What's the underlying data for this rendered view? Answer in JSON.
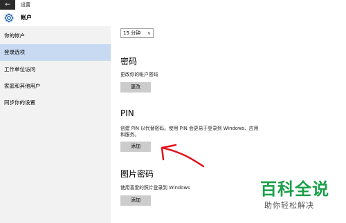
{
  "window": {
    "back_symbol": "←",
    "title": "设置"
  },
  "header": {
    "icon": "gear-icon",
    "title": "帐户"
  },
  "sidebar": {
    "items": [
      {
        "label": "你的帐户",
        "active": false
      },
      {
        "label": "登录选项",
        "active": true
      },
      {
        "label": "工作单位访问",
        "active": false
      },
      {
        "label": "家庭和其他用户",
        "active": false
      },
      {
        "label": "同步你的设置",
        "active": false
      }
    ]
  },
  "main": {
    "timeout_select": {
      "value": "15 分钟"
    },
    "password": {
      "title": "密码",
      "desc": "更改你的帐户密码",
      "button": "更改"
    },
    "pin": {
      "title": "PIN",
      "desc_line1": "创建 PIN 以代替密码。使用 PIN 会更易于登录到 Windows、应用",
      "desc_line2": "和服务。",
      "button": "添加"
    },
    "picture_password": {
      "title": "图片密码",
      "desc": "使用喜爱的照片登录到 Windows",
      "button": "添加"
    }
  },
  "annotation": {
    "arrow_color": "#e0141e"
  },
  "watermark": {
    "line1": "百科全说",
    "line2": "助你轻松解决"
  },
  "colors": {
    "sidebar_active": "#c8daf2",
    "sidebar_bg": "#f2f2f2",
    "button_bg": "#cccccc",
    "accent": "#1a5fb4"
  }
}
